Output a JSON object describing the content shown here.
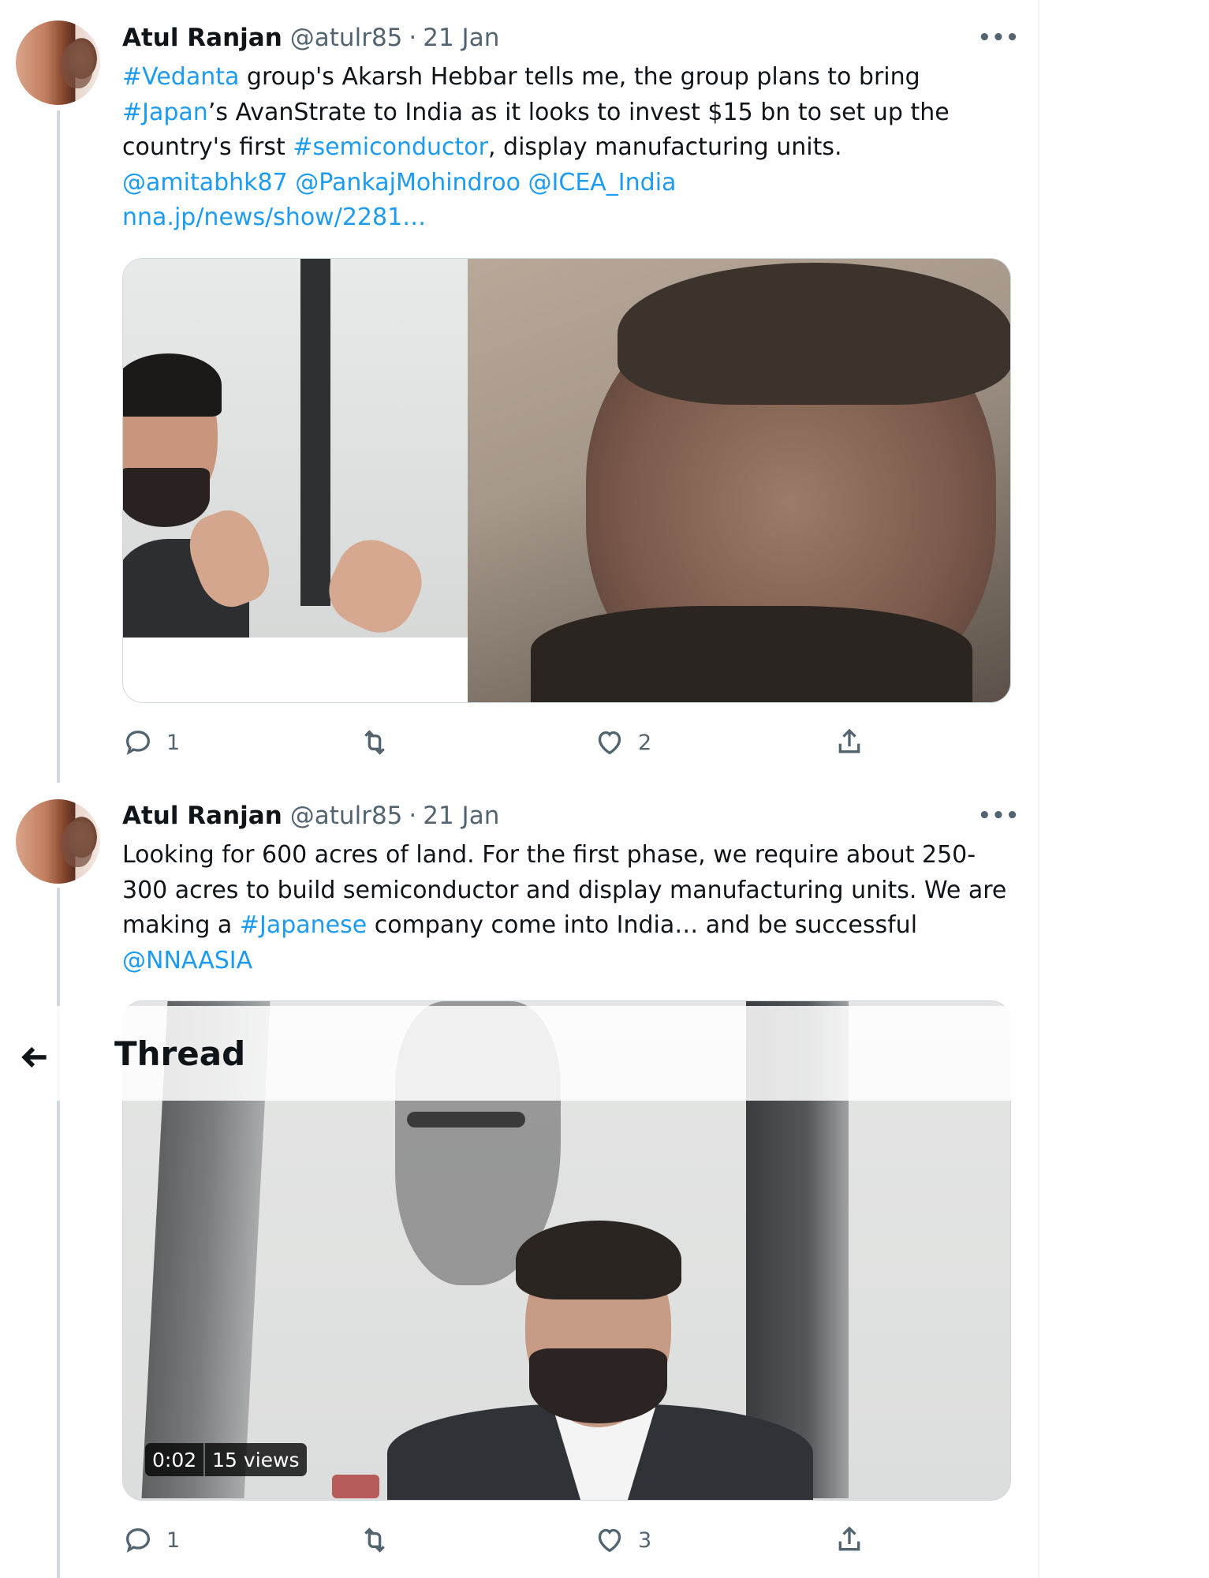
{
  "tweets": [
    {
      "author_name": "Atul Ranjan",
      "handle": "@atulr85",
      "separator": "·",
      "date": "21 Jan",
      "more": "•••",
      "text": [
        {
          "t": "#Vedanta",
          "link": true
        },
        {
          "t": " group's Akarsh Hebbar tells me, the group plans to bring\n",
          "link": false
        },
        {
          "t": "#Japan",
          "link": true
        },
        {
          "t": "’s AvanStrate to India as it looks to invest $15 bn to set up the\ncountry's first ",
          "link": false
        },
        {
          "t": "#semiconductor",
          "link": true
        },
        {
          "t": ", display manufacturing units.\n",
          "link": false
        },
        {
          "t": "@amitabhk87",
          "link": true
        },
        {
          "t": " ",
          "link": false
        },
        {
          "t": "@PankajMohindroo",
          "link": true
        },
        {
          "t": " ",
          "link": false
        },
        {
          "t": "@ICEA_India",
          "link": true
        },
        {
          "t": "\n",
          "link": false
        },
        {
          "t": "nna.jp/news/show/2281…",
          "link": true
        }
      ],
      "actions": {
        "reply": "1",
        "retweet": "",
        "like": "2",
        "share": ""
      }
    },
    {
      "author_name": "Atul Ranjan",
      "handle": "@atulr85",
      "separator": "·",
      "date": "21 Jan",
      "more": "•••",
      "text": [
        {
          "t": "Looking for 600 acres of land. For the first phase, we require about 250-\n300 acres to build semiconductor and display manufacturing units. We are\nmaking a ",
          "link": false
        },
        {
          "t": "#Japanese",
          "link": true
        },
        {
          "t": " company come into India… and be successful\n",
          "link": false
        },
        {
          "t": "@NNAASIA",
          "link": true
        }
      ],
      "video": {
        "duration": "0:02",
        "views": "15 views"
      },
      "actions": {
        "reply": "1",
        "retweet": "",
        "like": "3",
        "share": ""
      }
    }
  ],
  "header": {
    "title": "Thread",
    "back_icon": "arrow-left-icon"
  },
  "colors": {
    "link": "#1d9bf0",
    "muted": "#536471",
    "text": "#0f1419",
    "thread_line": "#cfd9de"
  }
}
